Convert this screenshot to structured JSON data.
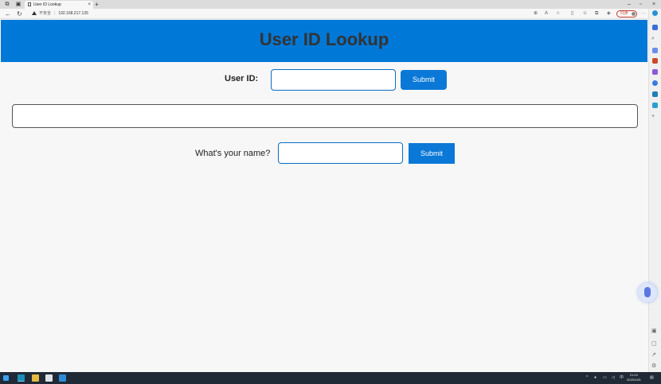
{
  "browser": {
    "tab_title": "User ID Lookup",
    "tab_close": "×",
    "new_tab": "+",
    "window_controls": [
      "–",
      "▫",
      "×"
    ],
    "insecure_label": "不安全",
    "url": "192.168.217.135",
    "profile_label": "同步"
  },
  "page": {
    "title": "User ID Lookup",
    "user_id_label": "User ID:",
    "user_id_value": "",
    "submit_1": "Submit",
    "result_text": "",
    "name_label": "What's your name?",
    "name_value": "",
    "submit_2": "Submit"
  },
  "taskbar": {
    "time": "21:13",
    "date": "2023/11/5",
    "ime": "中"
  },
  "colors": {
    "header_bg": "#0078d7",
    "button_bg": "#0a78d7",
    "input_border": "#0a6cc4"
  }
}
